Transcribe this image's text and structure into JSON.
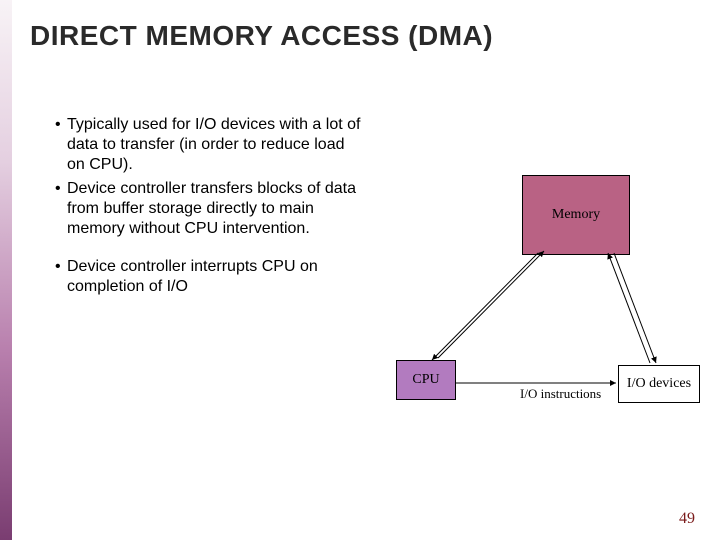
{
  "title": "DIRECT MEMORY ACCESS (DMA)",
  "bullets": {
    "b1": "Typically used for I/O devices with a lot of data to transfer (in order to reduce load on CPU).",
    "b2": "Device controller transfers blocks of data from buffer storage directly to main memory without CPU intervention.",
    "b3": "Device controller interrupts CPU on completion of I/O"
  },
  "diagram": {
    "memory_label": "Memory",
    "cpu_label": "CPU",
    "io_devices_label": "I/O devices",
    "io_instructions_label": "I/O instructions"
  },
  "page_number": "49"
}
